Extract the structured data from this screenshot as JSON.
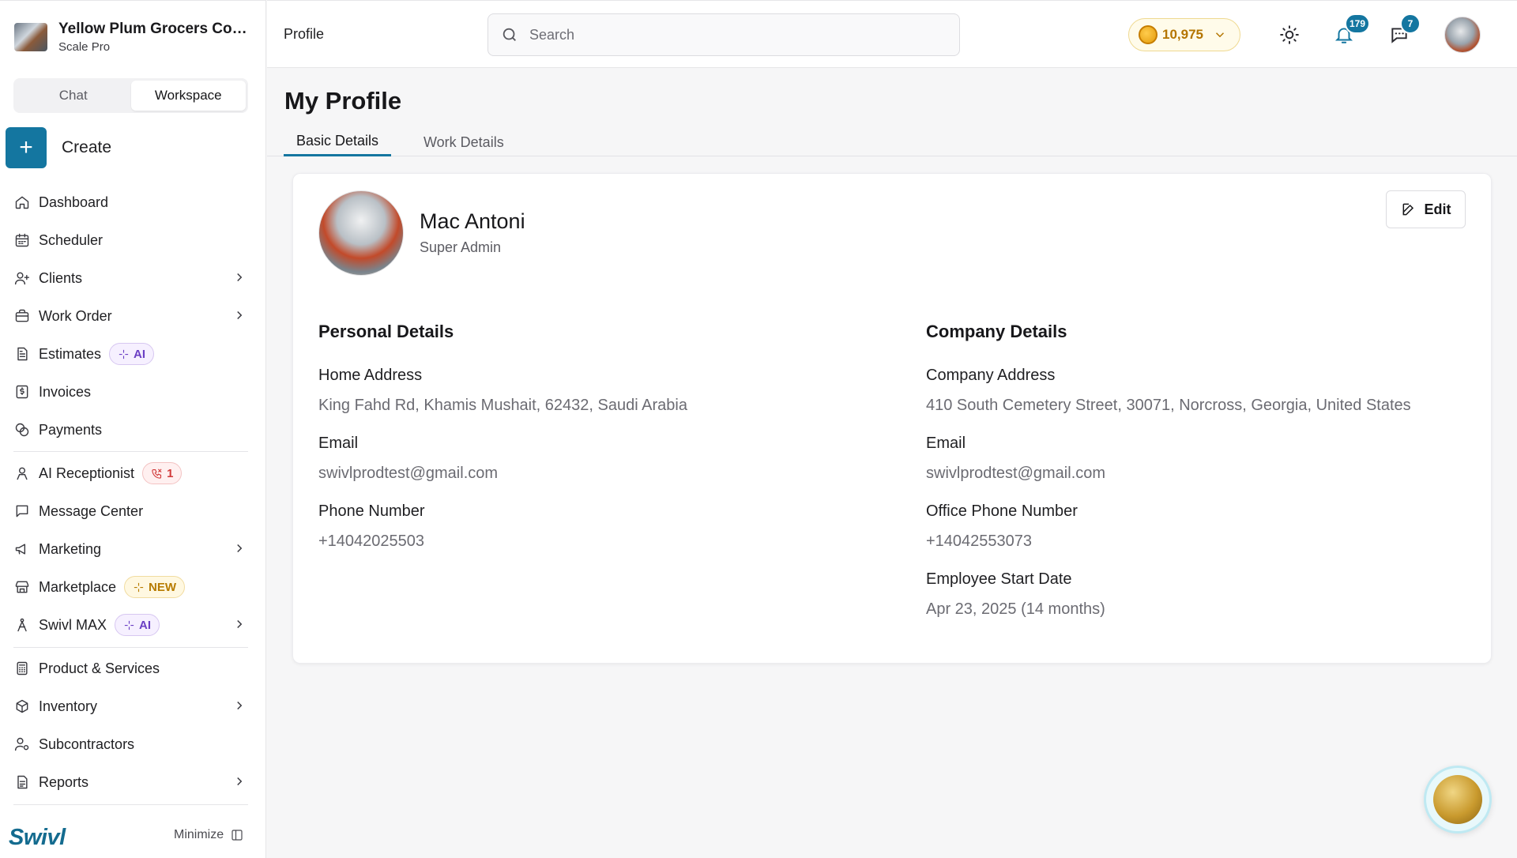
{
  "brand": {
    "name": "Yellow Plum Grocers Com...",
    "plan": "Scale Pro"
  },
  "sidebar": {
    "segments": [
      {
        "label": "Chat"
      },
      {
        "label": "Workspace"
      }
    ],
    "create_label": "Create",
    "items": [
      {
        "label": "Dashboard",
        "icon": "home-icon"
      },
      {
        "label": "Scheduler",
        "icon": "calendar-icon"
      },
      {
        "label": "Clients",
        "icon": "user-plus-icon"
      },
      {
        "label": "Work Order",
        "icon": "briefcase-icon"
      },
      {
        "label": "Estimates",
        "icon": "document-icon",
        "badge": "AI"
      },
      {
        "label": "Invoices",
        "icon": "dollar-doc-icon"
      },
      {
        "label": "Payments",
        "icon": "coins-icon"
      },
      {
        "label": "AI Receptionist",
        "icon": "receptionist-icon",
        "badge": "1"
      },
      {
        "label": "Message Center",
        "icon": "message-icon"
      },
      {
        "label": "Marketing",
        "icon": "megaphone-icon"
      },
      {
        "label": "Marketplace",
        "icon": "store-icon",
        "badge": "NEW"
      },
      {
        "label": "Swivl MAX",
        "icon": "max-icon",
        "badge": "AI"
      },
      {
        "label": "Product & Services",
        "icon": "calculator-icon"
      },
      {
        "label": "Inventory",
        "icon": "box-icon"
      },
      {
        "label": "Subcontractors",
        "icon": "users-gear-icon"
      },
      {
        "label": "Reports",
        "icon": "report-icon"
      }
    ],
    "footer": {
      "logo": "Swivl",
      "minimize_label": "Minimize"
    }
  },
  "topbar": {
    "title": "Profile",
    "search_placeholder": "Search",
    "credits": "10,975",
    "notifications_count": "179",
    "messages_count": "7"
  },
  "main": {
    "title": "My Profile",
    "tabs": [
      {
        "label": "Basic Details"
      },
      {
        "label": "Work Details"
      }
    ],
    "profile": {
      "name": "Mac Antoni",
      "role": "Super Admin",
      "edit_label": "Edit"
    },
    "personal": {
      "title": "Personal Details",
      "fields": [
        {
          "label": "Home Address",
          "value": "King Fahd Rd, Khamis Mushait, 62432, Saudi Arabia"
        },
        {
          "label": "Email",
          "value": "swivlprodtest@gmail.com"
        },
        {
          "label": "Phone Number",
          "value": "+14042025503"
        }
      ]
    },
    "company": {
      "title": "Company Details",
      "fields": [
        {
          "label": "Company Address",
          "value": "410 South Cemetery Street, 30071, Norcross, Georgia, United States"
        },
        {
          "label": "Email",
          "value": "swivlprodtest@gmail.com"
        },
        {
          "label": "Office Phone Number",
          "value": "+14042553073"
        },
        {
          "label": "Employee Start Date",
          "value": "Apr 23, 2025 (14 months)"
        }
      ]
    }
  },
  "colors": {
    "accent": "#1476a0",
    "credits": "#b47500",
    "ai_badge": "#6b3fc4",
    "new_badge": "#b77b00",
    "call_badge": "#d13a3a"
  }
}
